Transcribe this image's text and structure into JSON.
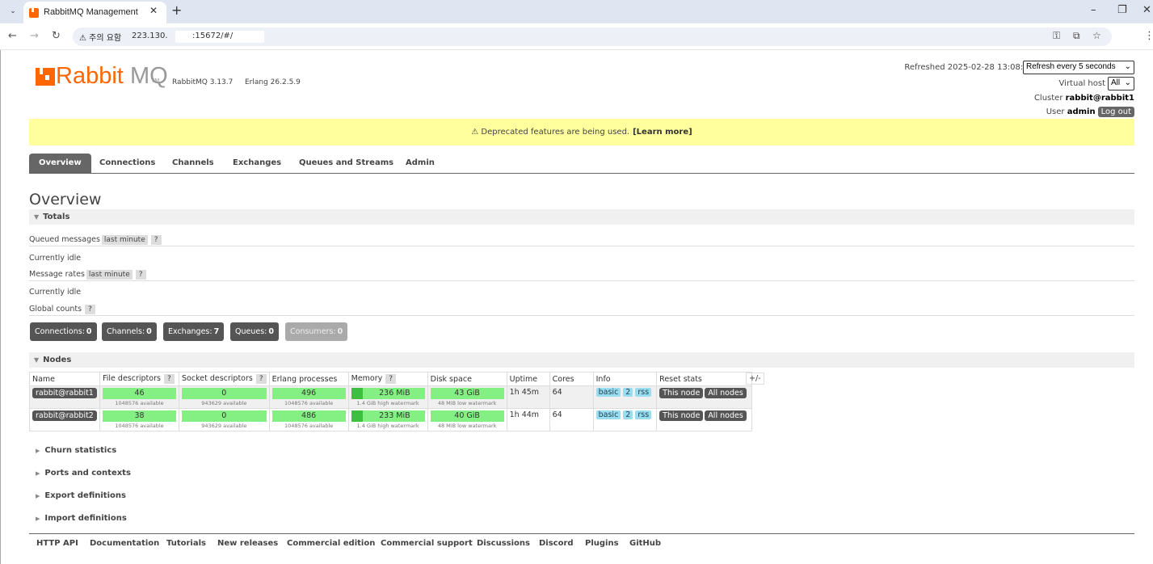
{
  "browser": {
    "tab_title": "RabbitMQ Management",
    "warning": "⚠ 주의 요함",
    "url_prefix": "223.130.",
    "url_suffix": ":15672/#/"
  },
  "header": {
    "logo_part1": "Rabbit",
    "logo_part2": "MQ",
    "logo_tm": "TM",
    "rabbitmq_version": "RabbitMQ 3.13.7",
    "erlang_version": "Erlang 26.2.5.9",
    "refreshed": "Refreshed 2025-02-28 13:08:27",
    "refresh_select": "Refresh every 5 seconds",
    "virtual_host_label": "Virtual host",
    "virtual_host_value": "All",
    "cluster_label": "Cluster",
    "cluster_value": "rabbit@rabbit1",
    "user_label": "User",
    "user_value": "admin",
    "logout": "Log out"
  },
  "banner": {
    "text": "⚠ Deprecated features are being used.",
    "link": "[Learn more]"
  },
  "tabs": [
    "Overview",
    "Connections",
    "Channels",
    "Exchanges",
    "Queues and Streams",
    "Admin"
  ],
  "page_title": "Overview",
  "totals": {
    "title": "Totals",
    "queued_label": "Queued messages",
    "queued_range": "last minute",
    "queued_status": "Currently idle",
    "rates_label": "Message rates",
    "rates_range": "last minute",
    "rates_status": "Currently idle",
    "global_label": "Global counts",
    "help": "?"
  },
  "counts": [
    {
      "label": "Connections:",
      "value": "0"
    },
    {
      "label": "Channels:",
      "value": "0"
    },
    {
      "label": "Exchanges:",
      "value": "7"
    },
    {
      "label": "Queues:",
      "value": "0"
    },
    {
      "label": "Consumers:",
      "value": "0"
    }
  ],
  "nodes": {
    "title": "Nodes",
    "headers": [
      "Name",
      "File descriptors",
      "Socket descriptors",
      "Erlang processes",
      "Memory",
      "Disk space",
      "Uptime",
      "Cores",
      "Info",
      "Reset stats"
    ],
    "plus_minus": "+/-",
    "rows": [
      {
        "name": "rabbit@rabbit1",
        "fd": "46",
        "fd_sub": "1048576 available",
        "sock": "0",
        "sock_sub": "943629 available",
        "proc": "496",
        "proc_sub": "1048576 available",
        "mem": "236 MiB",
        "mem_sub": "1.4 GiB high watermark",
        "mem_frac": 0.16,
        "disk": "43 GiB",
        "disk_sub": "48 MiB low watermark",
        "uptime": "1h 45m",
        "cores": "64",
        "info1": "basic",
        "info2": "2",
        "info3": "rss",
        "btn1": "This node",
        "btn2": "All nodes"
      },
      {
        "name": "rabbit@rabbit2",
        "fd": "38",
        "fd_sub": "1048576 available",
        "sock": "0",
        "sock_sub": "943629 available",
        "proc": "486",
        "proc_sub": "1048576 available",
        "mem": "233 MiB",
        "mem_sub": "1.4 GiB high watermark",
        "mem_frac": 0.16,
        "disk": "40 GiB",
        "disk_sub": "48 MiB low watermark",
        "uptime": "1h 44m",
        "cores": "64",
        "info1": "basic",
        "info2": "2",
        "info3": "rss",
        "btn1": "This node",
        "btn2": "All nodes"
      }
    ]
  },
  "collapsed": [
    "Churn statistics",
    "Ports and contexts",
    "Export definitions",
    "Import definitions"
  ],
  "footer": [
    "HTTP API",
    "Documentation",
    "Tutorials",
    "New releases",
    "Commercial edition",
    "Commercial support",
    "Discussions",
    "Discord",
    "Plugins",
    "GitHub"
  ]
}
